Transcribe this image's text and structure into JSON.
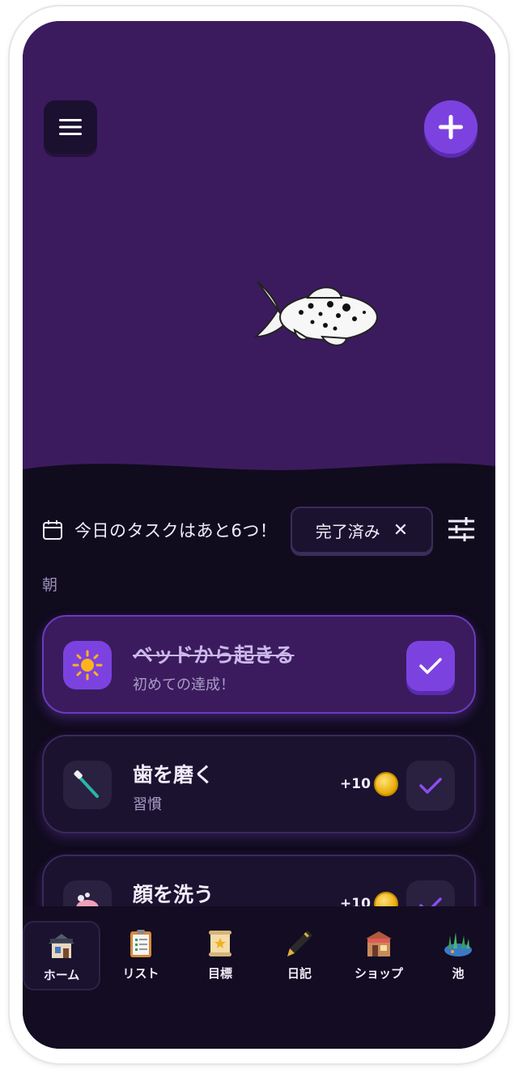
{
  "header": {
    "menu_icon": "hamburger-icon",
    "add_icon": "plus-icon"
  },
  "status": {
    "text": "今日のタスクはあと6つ！",
    "completed_chip_label": "完了済み",
    "completed_chip_close": "✕"
  },
  "section": {
    "label": "朝"
  },
  "tasks": [
    {
      "title": "ベッドから起きる",
      "subtitle": "初めての達成！",
      "icon": "sun-icon",
      "completed": true
    },
    {
      "title": "歯を磨く",
      "subtitle": "習慣",
      "reward": "+10",
      "icon": "toothbrush-icon",
      "completed": false
    },
    {
      "title": "顔を洗う",
      "reward": "+10",
      "icon": "soap-icon",
      "completed": false
    }
  ],
  "nav": [
    {
      "label": "ホーム",
      "icon": "house-icon",
      "active": true
    },
    {
      "label": "リスト",
      "icon": "clipboard-icon"
    },
    {
      "label": "目標",
      "icon": "scroll-icon"
    },
    {
      "label": "日記",
      "icon": "pen-icon"
    },
    {
      "label": "ショップ",
      "icon": "shop-icon"
    },
    {
      "label": "池",
      "icon": "pond-icon"
    }
  ],
  "colors": {
    "accent": "#7c42e0",
    "sky": "#3b1b5e",
    "background": "#110b1e"
  }
}
